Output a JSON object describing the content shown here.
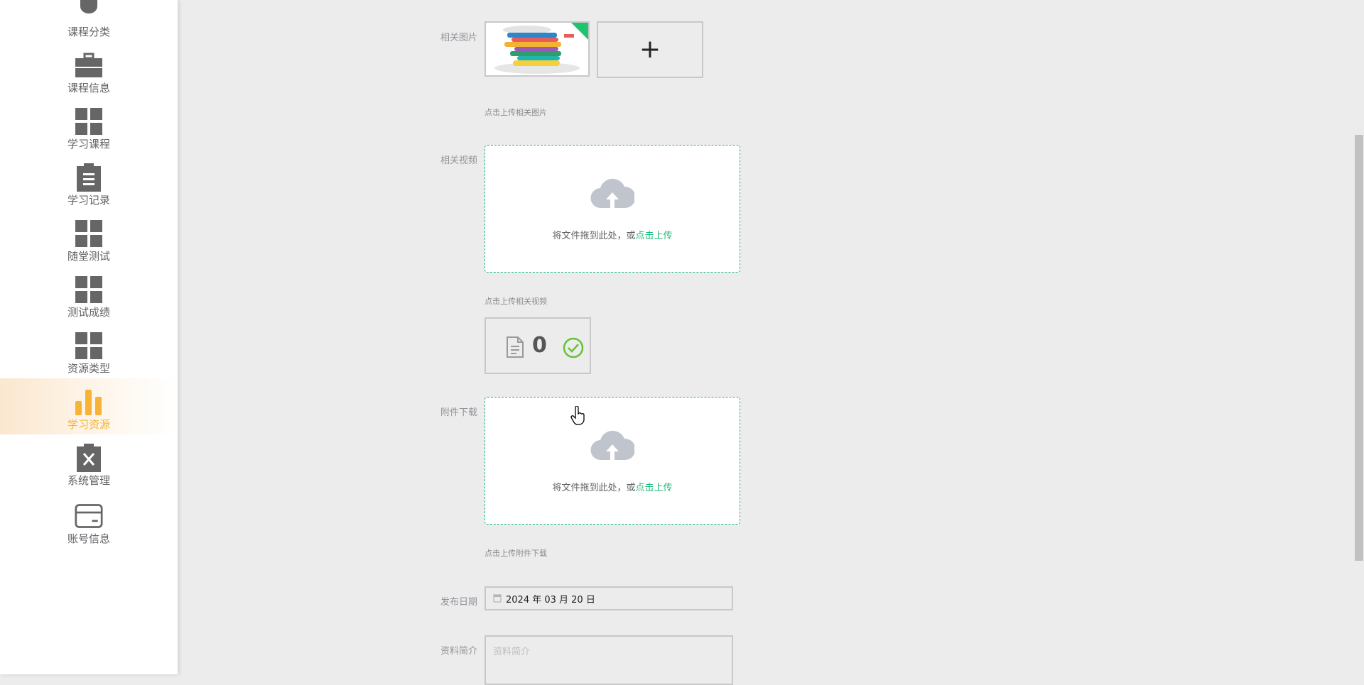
{
  "sidebar": {
    "items": [
      {
        "label": "课程分类",
        "icon": "lightbulb-icon",
        "active": false
      },
      {
        "label": "课程信息",
        "icon": "briefcase-icon",
        "active": false
      },
      {
        "label": "学习课程",
        "icon": "grid-icon",
        "active": false
      },
      {
        "label": "学习记录",
        "icon": "clipboard-icon",
        "active": false
      },
      {
        "label": "随堂测试",
        "icon": "grid-icon",
        "active": false
      },
      {
        "label": "测试成绩",
        "icon": "grid-icon",
        "active": false
      },
      {
        "label": "资源类型",
        "icon": "grid-icon",
        "active": false
      },
      {
        "label": "学习资源",
        "icon": "bar-chart-icon",
        "active": true
      },
      {
        "label": "系统管理",
        "icon": "clipboard-x-icon",
        "active": false
      },
      {
        "label": "账号信息",
        "icon": "card-icon",
        "active": false
      }
    ],
    "active_color": "#f6b335"
  },
  "form": {
    "image": {
      "label": "相关图片",
      "add_symbol": "+",
      "hint": "点击上传相关图片"
    },
    "video": {
      "label": "相关视频",
      "drop_text": "将文件拖到此处，或",
      "upload_link": "点击上传",
      "hint": "点击上传相关视频",
      "file_count": "0"
    },
    "attachment": {
      "label": "附件下载",
      "drop_text": "将文件拖到此处，或",
      "upload_link": "点击上传",
      "hint": "点击上传附件下载"
    },
    "publish_date": {
      "label": "发布日期",
      "value": "2024 年 03 月 20 日"
    },
    "summary": {
      "label": "资料简介",
      "placeholder": "资料简介"
    }
  },
  "colors": {
    "accent_green": "#1bb77a",
    "active_orange": "#f6b335",
    "background": "#ececec"
  }
}
